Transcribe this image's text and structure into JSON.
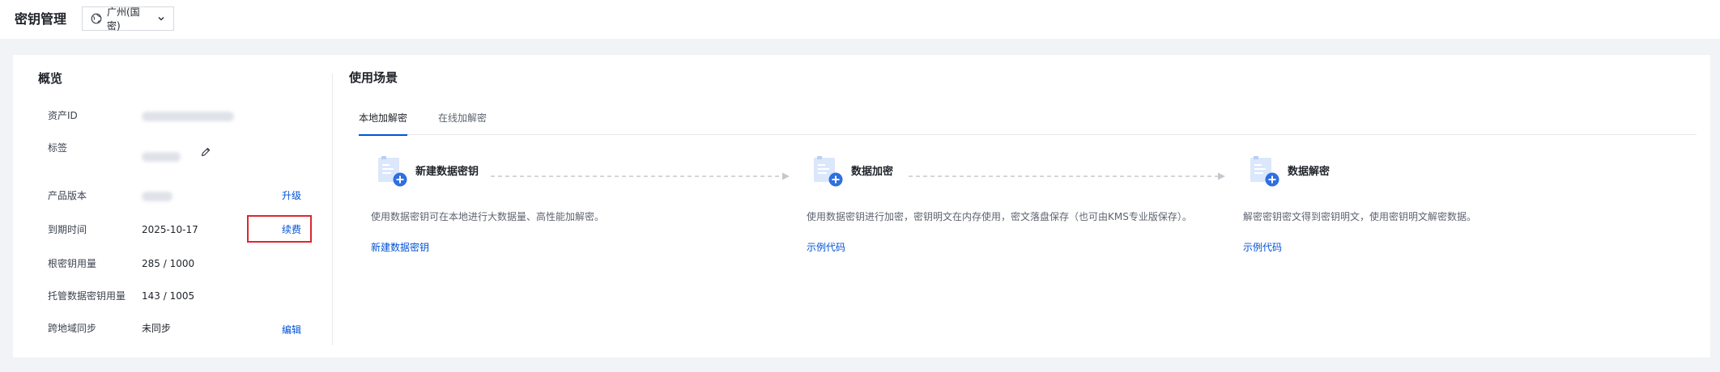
{
  "header": {
    "title": "密钥管理",
    "region": "广州(国密)"
  },
  "overview": {
    "title": "概览",
    "rows": [
      {
        "label": "资产ID",
        "value": ""
      },
      {
        "label": "标签",
        "value": ""
      },
      {
        "label": "产品版本",
        "value": "",
        "action": "升级"
      },
      {
        "label": "到期时间",
        "value": "2025-10-17",
        "action": "续费"
      },
      {
        "label": "根密钥用量",
        "value": "285 / 1000"
      },
      {
        "label": "托管数据密钥用量",
        "value": "143 / 1005"
      },
      {
        "label": "跨地域同步",
        "value": "未同步",
        "action": "编辑"
      }
    ]
  },
  "scenes": {
    "title": "使用场景",
    "tabs": [
      {
        "label": "本地加解密",
        "active": true
      },
      {
        "label": "在线加解密",
        "active": false
      }
    ],
    "steps": [
      {
        "title": "新建数据密钥",
        "desc": "使用数据密钥可在本地进行大数据量、高性能加解密。",
        "link": "新建数据密钥"
      },
      {
        "title": "数据加密",
        "desc": "使用数据密钥进行加密，密钥明文在内存使用，密文落盘保存（也可由KMS专业版保存）。",
        "link": "示例代码"
      },
      {
        "title": "数据解密",
        "desc": "解密密钥密文得到密钥明文，使用密钥明文解密数据。",
        "link": "示例代码"
      }
    ]
  },
  "colors": {
    "accent": "#0052d9",
    "highlight_box": "#e0262d",
    "background": "#f2f3f6"
  }
}
